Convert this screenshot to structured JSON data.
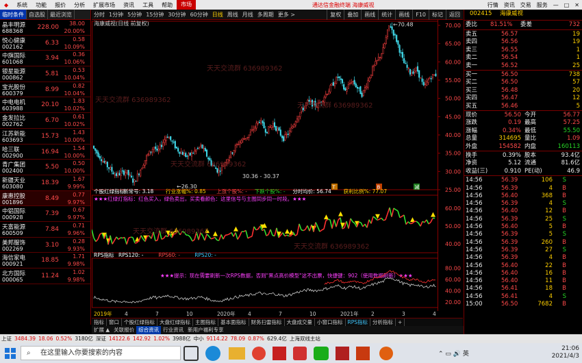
{
  "menubar": {
    "items": [
      "系统",
      "功能",
      "报价",
      "分析",
      "扩展市场",
      "资讯",
      "工具",
      "帮助"
    ],
    "active": "市场",
    "center_text": "通达信金融终端  海康威视",
    "right": [
      "行情",
      "资讯",
      "交易",
      "服务"
    ]
  },
  "left": {
    "tabs": [
      "临时条件",
      "自选股",
      "最近浏览"
    ],
    "rows": [
      {
        "name": "晶丰明源",
        "code": "688368",
        "price": "228.00",
        "chg": "38.00",
        "pct": "20.00%"
      },
      {
        "name": "悦心健康",
        "code": "002162",
        "price": "6.33",
        "chg": "0.58",
        "pct": "10.09%"
      },
      {
        "name": "中旗国际",
        "code": "601068",
        "price": "3.94",
        "chg": "0.36",
        "pct": "10.06%"
      },
      {
        "name": "银星能源",
        "code": "000862",
        "price": "5.81",
        "chg": "0.53",
        "pct": "10.04%"
      },
      {
        "name": "宝光股份",
        "code": "600379",
        "price": "8.99",
        "chg": "0.82",
        "pct": "10.04%"
      },
      {
        "name": "中电电机",
        "code": "603988",
        "price": "20.10",
        "chg": "1.83",
        "pct": "10.02%"
      },
      {
        "name": "金发拉比",
        "code": "002762",
        "price": "6.70",
        "chg": "0.61",
        "pct": "10.02%"
      },
      {
        "name": "江苏新能",
        "code": "603693",
        "price": "15.73",
        "chg": "1.43",
        "pct": "10.00%"
      },
      {
        "name": "哈三联",
        "code": "002900",
        "price": "16.94",
        "chg": "1.54",
        "pct": "10.00%"
      },
      {
        "name": "青广集团",
        "code": "002400",
        "price": "5.50",
        "chg": "0.50",
        "pct": "10.00%"
      },
      {
        "name": "新疆天业",
        "code": "603080",
        "price": "18.39",
        "chg": "1.67",
        "pct": "9.99%"
      },
      {
        "name": "康惠控股",
        "code": "001896",
        "price": "8.49",
        "chg": "0.77",
        "pct": "9.97%"
      },
      {
        "name": "中铝国际",
        "code": "000928",
        "price": "7.39",
        "chg": "0.67",
        "pct": "9.97%"
      },
      {
        "name": "天富能源",
        "code": "600509",
        "price": "7.84",
        "chg": "0.71",
        "pct": "9.96%"
      },
      {
        "name": "美邦服饰",
        "code": "002269",
        "price": "3.10",
        "chg": "0.28",
        "pct": "9.93%"
      },
      {
        "name": "海信家电",
        "code": "000921",
        "price": "18.85",
        "chg": "1.71",
        "pct": "9.98%"
      },
      {
        "name": "北方国际",
        "code": "000065",
        "price": "11.24",
        "chg": "1.02",
        "pct": "9.98%"
      }
    ]
  },
  "periodbar": {
    "items": [
      "分时",
      "1分钟",
      "5分钟",
      "15分钟",
      "30分钟",
      "60分钟",
      "日线",
      "周线",
      "月线",
      "多周期",
      "更多 >"
    ],
    "active": "日线",
    "right": [
      "复权",
      "叠加",
      "画线",
      "统计",
      "画线",
      "F10",
      "标记",
      "返回"
    ]
  },
  "chart": {
    "title": "海康威视(日线 前复权)",
    "price_axis": [
      "70.00",
      "65.00",
      "60.00",
      "55.00",
      "50.00",
      "45.00",
      "40.00",
      "35.00",
      "30.00",
      "25.00"
    ],
    "high_label": "70.48",
    "low_label": "26.30",
    "mid_label": "30.36 - 30.37",
    "watermark": "天天交流群  636989362",
    "ind1_legend": [
      {
        "t": "个股红绿指标",
        "c": "#ffffff"
      },
      {
        "t": "新常号: 3.18",
        "c": "#ffffff"
      },
      {
        "t": "行业涨幅%: 0.85",
        "c": "#ffd000"
      },
      {
        "t": "上涨个股%: -",
        "c": "#ff4a4a"
      },
      {
        "t": "下跌个股%: -",
        "c": "#26d626"
      },
      {
        "t": "分时均价: 56.74",
        "c": "#ffffff"
      },
      {
        "t": "获利比例%: 77.07",
        "c": "#ffd000"
      }
    ],
    "ind1_text": "★★★红绿灯指标：红色买入，绿色卖出，买卖看颜色：这里信号与主图同步同一时段。★★★",
    "ind1_axis": [
      "60.00",
      "50.00",
      "40.00"
    ],
    "rps_legend": [
      {
        "t": "RPS指标",
        "c": "#ffffff"
      },
      {
        "t": "RPS120: -",
        "c": "#ffffff"
      },
      {
        "t": "RPS60: -",
        "c": "#ff4a4a"
      },
      {
        "t": "RPS20: -",
        "c": "#40c8ff"
      }
    ],
    "rps_text": "★★★提示：现在需要刷新一次RPS数据，否则\"黑点高价模型\"这不出票，快捷键：902（使用数据刷新）★★★",
    "rps_axis": [
      "80.00",
      "60.00",
      "40.00",
      "20.00"
    ],
    "time_axis": [
      "2019年",
      "4",
      "7",
      "10",
      "2020年",
      "4",
      "7",
      "10",
      "2021年",
      "2",
      "3",
      "4"
    ],
    "markers": [
      "T",
      "B",
      "减"
    ]
  },
  "bottomtabs": [
    "指标",
    "窗口",
    "个股红绿指标",
    "大盘红绿指标",
    "主图指标",
    "基本面指标",
    "财务扫雷指标",
    "大盘成交量",
    "小窗口指标",
    "RPS指标",
    "分析指标",
    "+"
  ],
  "bottom_active": "RPS指标",
  "subtabs": {
    "items": [
      "扩展 ▲",
      "关联报价",
      "综合资讯",
      "行业资讯",
      "新用户福利专享"
    ],
    "active": "综合资讯",
    "right": "图文F10",
    "right_hl": "经营"
  },
  "statusbar": {
    "items": [
      {
        "t": "上证",
        "c": "n"
      },
      {
        "t": "3484.39",
        "c": "r"
      },
      {
        "t": "18.06",
        "c": "r"
      },
      {
        "t": "0.52%",
        "c": "r"
      },
      {
        "t": "3180亿",
        "c": "n"
      },
      {
        "t": "深证",
        "c": "n"
      },
      {
        "t": "14122.6",
        "c": "r"
      },
      {
        "t": "142.92",
        "c": "r"
      },
      {
        "t": "1.02%",
        "c": "r"
      },
      {
        "t": "3988亿",
        "c": "n"
      },
      {
        "t": "中小",
        "c": "n"
      },
      {
        "t": "9114.22",
        "c": "r"
      },
      {
        "t": "78.09",
        "c": "r"
      },
      {
        "t": "0.87%",
        "c": "r"
      },
      {
        "t": "629.4亿",
        "c": "n"
      },
      {
        "t": "上海双线主站",
        "c": "n"
      }
    ]
  },
  "taskbar": {
    "search_placeholder": "在这里输入你要搜索的内容",
    "time": "21:06",
    "date": "2021/4/3"
  },
  "quote": {
    "title_code": "002415",
    "title_name": "海康威视",
    "wb": {
      "label": "委比",
      "v1": "81.51%",
      "label2": "委差",
      "v2": "732"
    },
    "asks": [
      {
        "l": "卖五",
        "p": "56.57",
        "v": "19"
      },
      {
        "l": "卖四",
        "p": "56.56",
        "v": "19"
      },
      {
        "l": "卖三",
        "p": "56.55",
        "v": "1"
      },
      {
        "l": "卖二",
        "p": "56.54",
        "v": "1"
      },
      {
        "l": "卖一",
        "p": "56.52",
        "v": "25"
      }
    ],
    "bids": [
      {
        "l": "买一",
        "p": "56.50",
        "v": "738"
      },
      {
        "l": "买二",
        "p": "56.50",
        "v": "57"
      },
      {
        "l": "买三",
        "p": "56.48",
        "v": "20"
      },
      {
        "l": "买四",
        "p": "56.47",
        "v": "12"
      },
      {
        "l": "买五",
        "p": "56.46",
        "v": "5"
      }
    ],
    "stats": [
      {
        "l1": "现价",
        "v1": "56.50",
        "c1": "red",
        "l2": "今开",
        "v2": "56.77",
        "c2": "red"
      },
      {
        "l1": "涨跌",
        "v1": "0.19",
        "c1": "red",
        "l2": "最高",
        "v2": "57.25",
        "c2": "red"
      },
      {
        "l1": "涨幅",
        "v1": "0.34%",
        "c1": "red",
        "l2": "最低",
        "v2": "55.50",
        "c2": "green"
      },
      {
        "l1": "总量",
        "v1": "314695",
        "c1": "yellow",
        "l2": "量比",
        "v2": "1.09",
        "c2": "red"
      },
      {
        "l1": "外盘",
        "v1": "154582",
        "c1": "red",
        "l2": "内盘",
        "v2": "160113",
        "c2": "green"
      }
    ],
    "stats2": [
      {
        "l1": "换手",
        "v1": "0.39%",
        "l2": "股本",
        "v2": "93.4亿"
      },
      {
        "l1": "净资",
        "v1": "5.12",
        "l2": "流通",
        "v2": "81.6亿"
      },
      {
        "l1": "收益(三)",
        "v1": "0.910",
        "l2": "PE(动)",
        "v2": "46.9"
      }
    ],
    "ticks": [
      {
        "t": "14:56",
        "p": "56.39",
        "v": "106",
        "d": "S"
      },
      {
        "t": "14:56",
        "p": "56.39",
        "v": "4",
        "d": "B"
      },
      {
        "t": "14:56",
        "p": "56.40",
        "v": "368",
        "d": "B"
      },
      {
        "t": "14:56",
        "p": "56.39",
        "v": "4",
        "d": "S"
      },
      {
        "t": "14:56",
        "p": "56.40",
        "v": "12",
        "d": "B"
      },
      {
        "t": "14:56",
        "p": "56.39",
        "v": "25",
        "d": "S"
      },
      {
        "t": "14:56",
        "p": "56.40",
        "v": "5",
        "d": "B"
      },
      {
        "t": "14:56",
        "p": "56.39",
        "v": "5",
        "d": "S"
      },
      {
        "t": "14:56",
        "p": "56.39",
        "v": "260",
        "d": "B"
      },
      {
        "t": "14:56",
        "p": "56.39",
        "v": "27",
        "d": "S"
      },
      {
        "t": "14:56",
        "p": "56.39",
        "v": "4",
        "d": "B"
      },
      {
        "t": "14:56",
        "p": "56.40",
        "v": "22",
        "d": "B"
      },
      {
        "t": "14:56",
        "p": "56.40",
        "v": "16",
        "d": "B"
      },
      {
        "t": "14:56",
        "p": "56.40",
        "v": "11",
        "d": "B"
      },
      {
        "t": "14:56",
        "p": "56.41",
        "v": "18",
        "d": "B"
      },
      {
        "t": "14:56",
        "p": "56.41",
        "v": "4",
        "d": "S"
      },
      {
        "t": "15:00",
        "p": "56.50",
        "v": "7682",
        "d": "B"
      }
    ]
  }
}
